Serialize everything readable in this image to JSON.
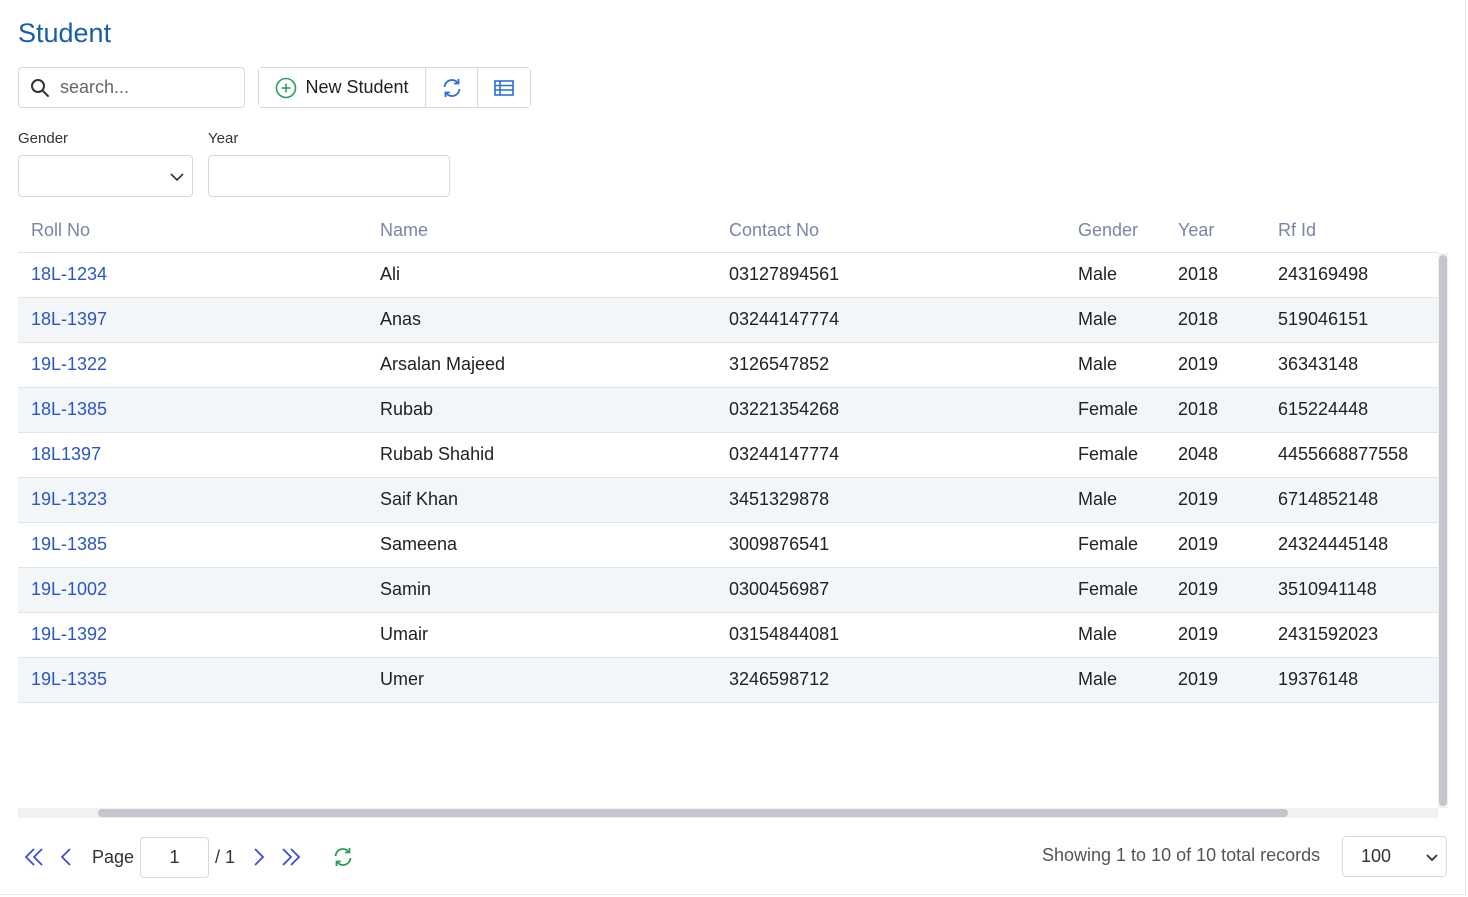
{
  "page": {
    "title": "Student"
  },
  "toolbar": {
    "search_placeholder": "search...",
    "new_button_label": "New Student",
    "icons": [
      "search-icon",
      "plus-circle-icon",
      "refresh-icon",
      "table-view-icon"
    ]
  },
  "filters": {
    "gender_label": "Gender",
    "gender_value": "",
    "year_label": "Year",
    "year_value": ""
  },
  "table": {
    "columns": [
      "Roll No",
      "Name",
      "Contact No",
      "Gender",
      "Year",
      "Rf Id"
    ],
    "rows": [
      [
        "18L-1234",
        "Ali",
        "03127894561",
        "Male",
        "2018",
        "243169498"
      ],
      [
        "18L-1397",
        "Anas",
        "03244147774",
        "Male",
        "2018",
        "519046151"
      ],
      [
        "19L-1322",
        "Arsalan Majeed",
        "3126547852",
        "Male",
        "2019",
        "36343148"
      ],
      [
        "18L-1385",
        "Rubab",
        "03221354268",
        "Female",
        "2018",
        "615224448"
      ],
      [
        "18L1397",
        "Rubab Shahid",
        "03244147774",
        "Female",
        "2048",
        "4455668877558"
      ],
      [
        "19L-1323",
        "Saif Khan",
        "3451329878",
        "Male",
        "2019",
        "6714852148"
      ],
      [
        "19L-1385",
        "Sameena",
        "3009876541",
        "Female",
        "2019",
        "24324445148"
      ],
      [
        "19L-1002",
        "Samin",
        "0300456987",
        "Female",
        "2019",
        "3510941148"
      ],
      [
        "19L-1392",
        "Umair",
        "03154844081",
        "Male",
        "2019",
        "2431592023"
      ],
      [
        "19L-1335",
        "Umer",
        "3246598712",
        "Male",
        "2019",
        "19376148"
      ]
    ]
  },
  "pager": {
    "page_label": "Page",
    "current_page": "1",
    "total_pages": "/ 1",
    "status": "Showing 1 to 10 of 10 total records",
    "page_size": "100"
  },
  "colors": {
    "title": "#1a5fa6",
    "link": "#2a56c6",
    "header_text": "#7a84a6",
    "refresh_green": "#2e9c5a",
    "nav_blue": "#3b4fd8"
  }
}
